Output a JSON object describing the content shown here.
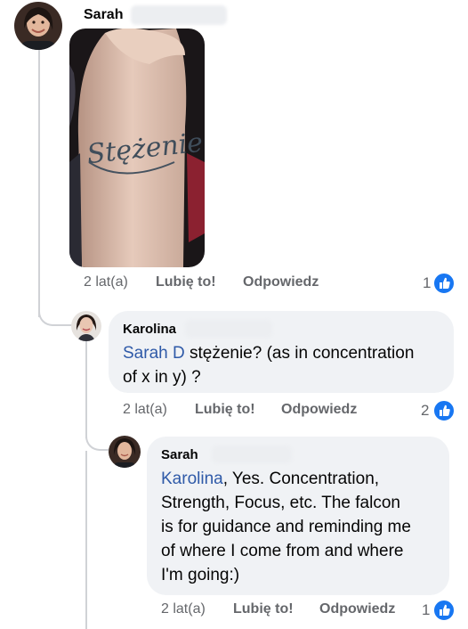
{
  "comments": [
    {
      "author": "Sarah",
      "time": "2 lat(a)",
      "like_label": "Lubię to!",
      "reply_label": "Odpowiedz",
      "like_count": "1",
      "photo_tattoo_text": "Stężenie"
    },
    {
      "author": "Karolina",
      "mention": "Sarah D",
      "text_line1": " stężenie? (as in concentration",
      "text_line2": "of x in y) ?",
      "time": "2 lat(a)",
      "like_label": "Lubię to!",
      "reply_label": "Odpowiedz",
      "like_count": "2"
    },
    {
      "author": "Sarah",
      "mention": "Karolina",
      "text_line1": ", Yes. Concentration,",
      "text_line2": "Strength, Focus, etc. The falcon",
      "text_line3": "is for guidance and reminding me",
      "text_line4": "of where I come from and where",
      "text_line5": "I'm going:)",
      "time": "2 lat(a)",
      "like_label": "Lubię to!",
      "reply_label": "Odpowiedz",
      "like_count": "1"
    }
  ],
  "colors": {
    "like_blue": "#1877f2",
    "mention_blue": "#2f5aa8",
    "bubble_bg": "#f0f2f5",
    "meta_gray": "#65676b"
  },
  "icons": [
    "avatar",
    "thumbs-up-icon"
  ]
}
